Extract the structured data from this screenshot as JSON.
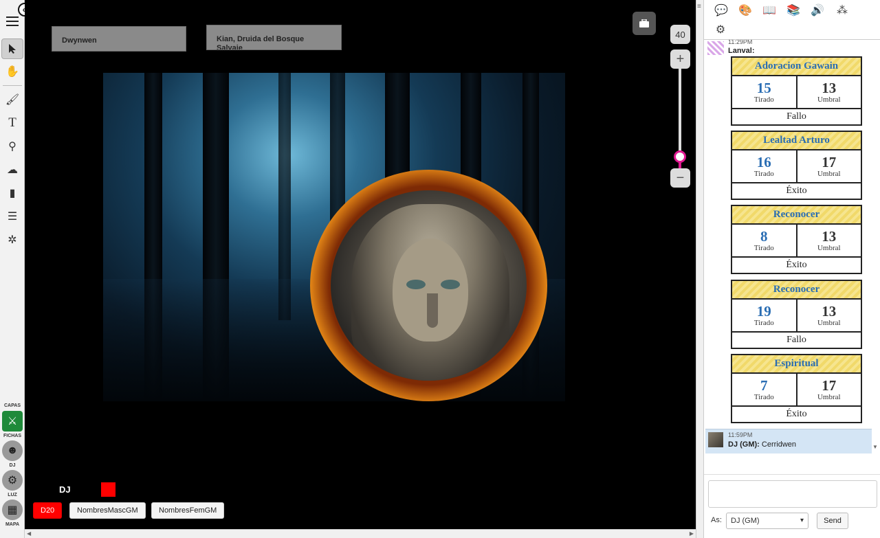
{
  "toolbar": {
    "collapse_icon": "double-chevron-left-icon",
    "layers": {
      "capas": "CAPAS",
      "fichas": "FICHAS",
      "dj": "DJ",
      "luz": "LUZ",
      "mapa": "MAPA"
    }
  },
  "canvas": {
    "nameplates": [
      "Dwynwen",
      "Kian, Druida del Bosque Salvaje"
    ],
    "zoom_level": "40",
    "zoom_in": "+",
    "zoom_out": "−",
    "player": {
      "name": "DJ",
      "color": "#ff0000"
    },
    "macros": [
      "D20",
      "NombresMascGM",
      "NombresFemGM"
    ]
  },
  "chat": {
    "first_msg": {
      "time": "11:29PM",
      "who": "Lanval:"
    },
    "rolls": [
      {
        "title": "Adoracion Gawain",
        "roll": "15",
        "roll_label": "Tirado",
        "threshold": "13",
        "threshold_label": "Umbral",
        "result": "Fallo"
      },
      {
        "title": "Lealtad Arturo",
        "roll": "16",
        "roll_label": "Tirado",
        "threshold": "17",
        "threshold_label": "Umbral",
        "result": "Éxito"
      },
      {
        "title": "Reconocer",
        "roll": "8",
        "roll_label": "Tirado",
        "threshold": "13",
        "threshold_label": "Umbral",
        "result": "Éxito"
      },
      {
        "title": "Reconocer",
        "roll": "19",
        "roll_label": "Tirado",
        "threshold": "13",
        "threshold_label": "Umbral",
        "result": "Fallo"
      },
      {
        "title": "Espiritual",
        "roll": "7",
        "roll_label": "Tirado",
        "threshold": "17",
        "threshold_label": "Umbral",
        "result": "Éxito"
      }
    ],
    "gm_msg": {
      "time": "11:59PM",
      "who": "DJ (GM):",
      "text": "Cerridwen"
    },
    "as_label": "As:",
    "as_value": "DJ (GM)",
    "send_label": "Send"
  },
  "colors": {
    "accent": "#e01890",
    "roll_blue": "#2a6db3",
    "gm_highlight": "#d4e5f5"
  }
}
